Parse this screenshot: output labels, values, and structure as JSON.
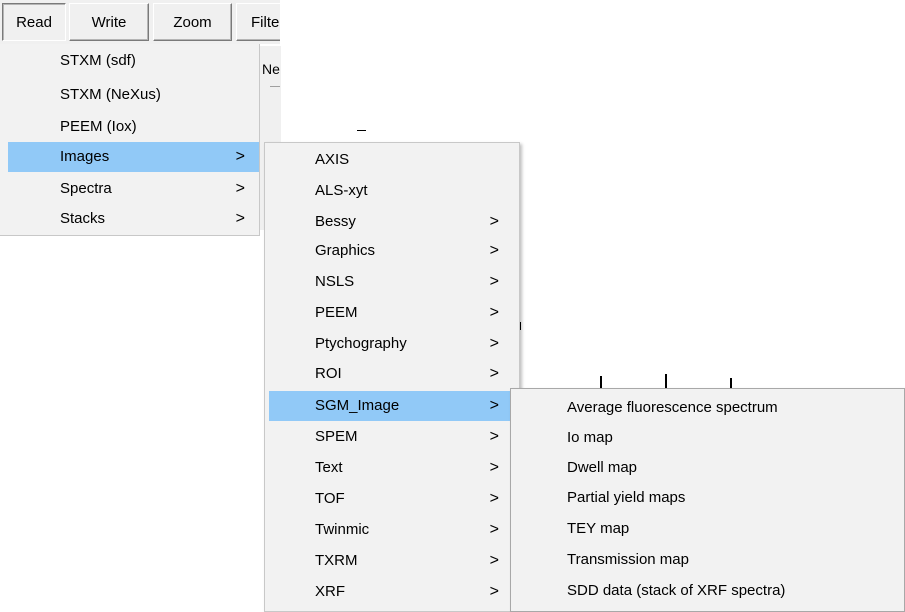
{
  "menubar": {
    "items": [
      {
        "label": "Read"
      },
      {
        "label": "Write"
      },
      {
        "label": "Zoom"
      },
      {
        "label": "Filte"
      }
    ]
  },
  "background": {
    "tab_fragment": "Ne"
  },
  "read_menu": {
    "items": [
      {
        "label": "STXM (sdf)"
      },
      {
        "label": "STXM (NeXus)"
      },
      {
        "label": "PEEM (Iox)"
      },
      {
        "label": "Images",
        "arrow": ">"
      },
      {
        "label": "Spectra",
        "arrow": ">"
      },
      {
        "label": "Stacks",
        "arrow": ">"
      }
    ]
  },
  "images_menu": {
    "items": [
      {
        "label": "AXIS"
      },
      {
        "label": "ALS-xyt"
      },
      {
        "label": "Bessy",
        "arrow": ">"
      },
      {
        "label": "Graphics",
        "arrow": ">"
      },
      {
        "label": "NSLS",
        "arrow": ">"
      },
      {
        "label": "PEEM",
        "arrow": ">"
      },
      {
        "label": "Ptychography",
        "arrow": ">"
      },
      {
        "label": "ROI",
        "arrow": ">"
      },
      {
        "label": "SGM_Image",
        "arrow": ">"
      },
      {
        "label": "SPEM",
        "arrow": ">"
      },
      {
        "label": "Text",
        "arrow": ">"
      },
      {
        "label": "TOF",
        "arrow": ">"
      },
      {
        "label": "Twinmic",
        "arrow": ">"
      },
      {
        "label": "TXRM",
        "arrow": ">"
      },
      {
        "label": "XRF",
        "arrow": ">"
      }
    ]
  },
  "sgm_menu": {
    "items": [
      {
        "label": "Average fluorescence spectrum"
      },
      {
        "label": "Io map"
      },
      {
        "label": "Dwell map"
      },
      {
        "label": "Partial yield maps"
      },
      {
        "label": "TEY map"
      },
      {
        "label": "Transmission map"
      },
      {
        "label": "SDD data (stack of XRF spectra)"
      }
    ]
  },
  "highlight": {
    "read_menu": "Images",
    "images_menu": "SGM_Image",
    "color": "#91c9f7"
  }
}
